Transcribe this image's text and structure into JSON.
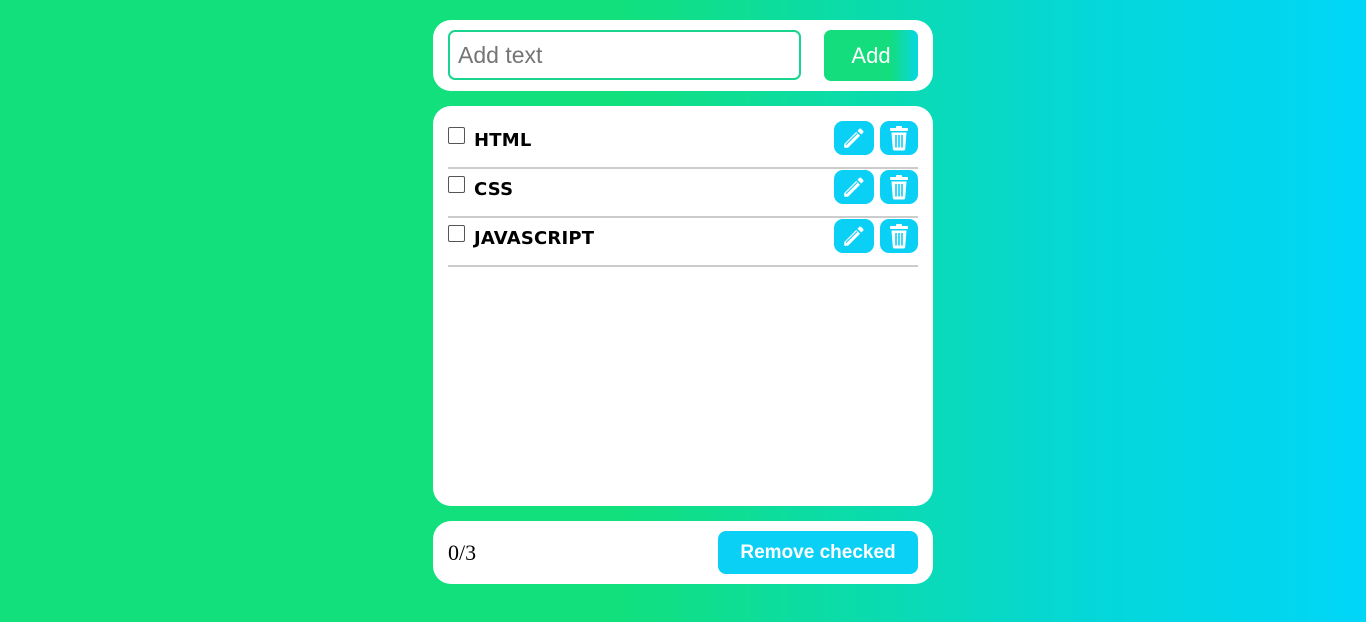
{
  "input": {
    "value": "",
    "placeholder": "Add text"
  },
  "add_label": "Add",
  "todos": [
    {
      "label": "HTML",
      "checked": false
    },
    {
      "label": "CSS",
      "checked": false
    },
    {
      "label": "JAVASCRIPT",
      "checked": false
    }
  ],
  "icons": {
    "edit": "pencil-icon",
    "delete": "trash-icon"
  },
  "footer": {
    "counter": "0/3",
    "remove_label": "Remove checked"
  },
  "colors": {
    "background_start": "#11e07c",
    "background_end": "#00d6f8",
    "accent": "#0bd0f5",
    "input_border": "#19d48e"
  }
}
